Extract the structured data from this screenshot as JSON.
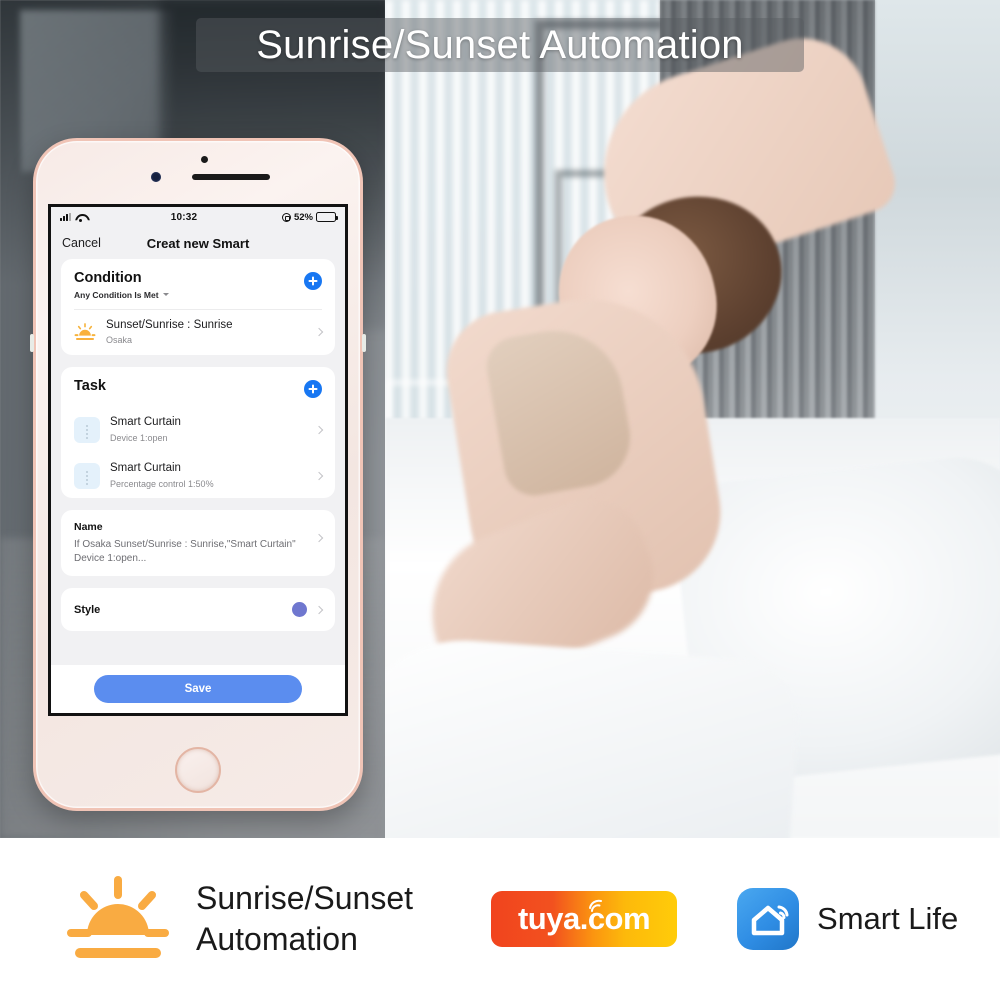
{
  "banner": {
    "title": "Sunrise/Sunset Automation"
  },
  "phone": {
    "statusbar": {
      "time": "10:32",
      "battery_percent": "52%",
      "signal_icon": "cellular-signal-icon",
      "wifi_icon": "wifi-icon",
      "lock_icon": "rotation-lock-icon",
      "battery_icon": "battery-icon"
    },
    "navbar": {
      "cancel": "Cancel",
      "title": "Creat new Smart"
    },
    "condition": {
      "title": "Condition",
      "subtitle": "Any Condition Is Met",
      "add_label": "+",
      "items": [
        {
          "icon": "sunrise-icon",
          "title": "Sunset/Sunrise : Sunrise",
          "subtitle": "Osaka"
        }
      ]
    },
    "task": {
      "title": "Task",
      "add_label": "+",
      "items": [
        {
          "icon": "curtain-icon",
          "title": "Smart Curtain",
          "subtitle": "Device 1:open"
        },
        {
          "icon": "curtain-icon",
          "title": "Smart Curtain",
          "subtitle": "Percentage control 1:50%"
        }
      ]
    },
    "name": {
      "label": "Name",
      "value": "If Osaka Sunset/Sunrise : Sunrise,\"Smart Curtain\" Device 1:open..."
    },
    "style": {
      "label": "Style",
      "swatch_color": "#6f77cf"
    },
    "save": {
      "label": "Save",
      "color": "#5b8def"
    }
  },
  "footer": {
    "feature_icon": "sunrise-logo-icon",
    "feature_title_line1": "Sunrise/Sunset",
    "feature_title_line2": "Automation",
    "tuya": {
      "text": "tuya",
      "suffix": ".com",
      "wifi_icon": "tuya-wifi-icon"
    },
    "smartlife": {
      "icon": "smart-life-house-icon",
      "label": "Smart Life"
    }
  },
  "colors": {
    "accent_blue": "#1877f2",
    "save_blue": "#5b8def",
    "style_purple": "#6f77cf",
    "sun_orange": "#f9ab42",
    "tuya_red": "#f1441e",
    "tuya_yellow": "#ffcc09",
    "smartlife_blue": "#3b95e8"
  }
}
